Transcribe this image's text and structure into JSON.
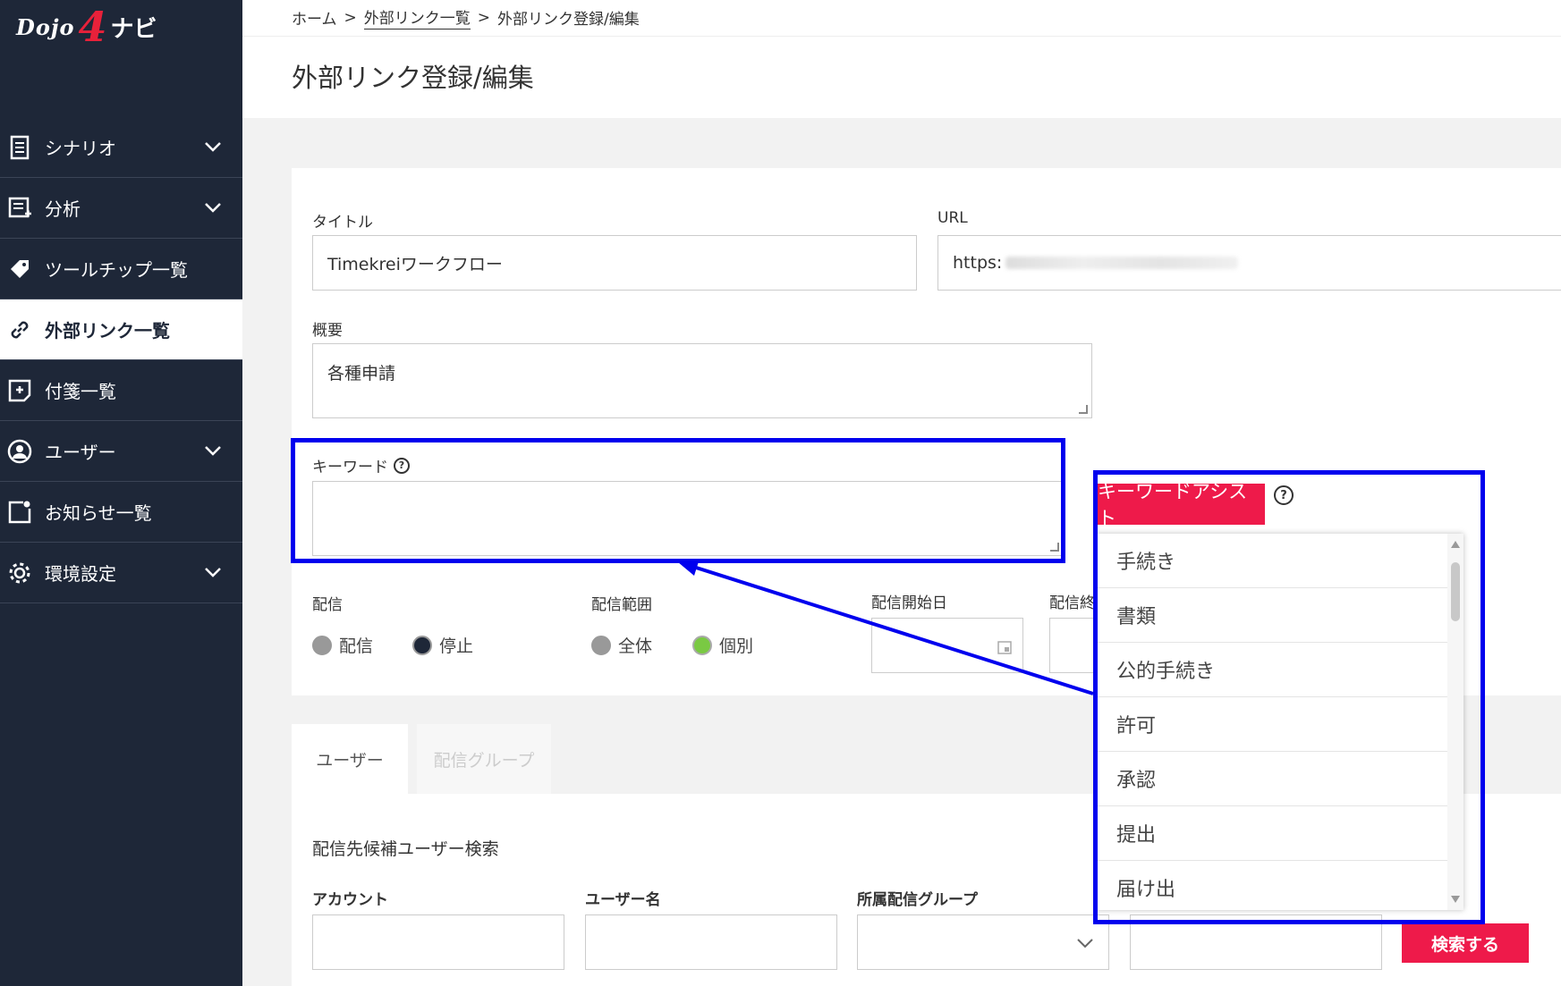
{
  "sidebar": {
    "logo_dojo": "Dojo",
    "logo_four": "4",
    "logo_navi": "ナビ",
    "items": [
      {
        "label": "シナリオ",
        "icon": "document-icon",
        "expandable": true
      },
      {
        "label": "分析",
        "icon": "analysis-icon",
        "expandable": true
      },
      {
        "label": "ツールチップ一覧",
        "icon": "tag-icon",
        "expandable": false
      },
      {
        "label": "外部リンク一覧",
        "icon": "link-icon",
        "expandable": false,
        "active": true
      },
      {
        "label": "付箋一覧",
        "icon": "sticky-note-icon",
        "expandable": false
      },
      {
        "label": "ユーザー",
        "icon": "user-icon",
        "expandable": true
      },
      {
        "label": "お知らせ一覧",
        "icon": "notice-icon",
        "expandable": false
      },
      {
        "label": "環境設定",
        "icon": "gear-icon",
        "expandable": true
      }
    ]
  },
  "header": {
    "breadcrumb": [
      "ホーム",
      "外部リンク一覧",
      "外部リンク登録/編集"
    ],
    "title": "外部リンク登録/編集"
  },
  "form": {
    "title_label": "タイトル",
    "title_value": "Timekreiワークフロー",
    "url_label": "URL",
    "url_value": "https:",
    "summary_label": "概要",
    "summary_value": "各種申請",
    "keyword_label": "キーワード",
    "keyword_value": "",
    "delivery_label": "配信",
    "delivery_options": [
      "配信",
      "停止"
    ],
    "delivery_selected": "停止",
    "scope_label": "配信範囲",
    "scope_options": [
      "全体",
      "個別"
    ],
    "scope_selected": "個別",
    "start_label": "配信開始日",
    "end_label": "配信終"
  },
  "assist": {
    "button_label": "キーワードアシスト",
    "help": "?",
    "items": [
      "手続き",
      "書類",
      "公的手続き",
      "許可",
      "承認",
      "提出",
      "届け出"
    ]
  },
  "tabs": {
    "user": "ユーザー",
    "group": "配信グループ"
  },
  "search": {
    "heading": "配信先候補ユーザー検索",
    "account_label": "アカウント",
    "username_label": "ユーザー名",
    "group_label": "所属配信グループ",
    "button": "検索する"
  },
  "colors": {
    "sidebar_bg": "#1e2738",
    "accent": "#ee1a4a",
    "highlight": "#0000ee",
    "radio_selected_dark": "#1e2738",
    "radio_selected_green": "#7ac943"
  }
}
